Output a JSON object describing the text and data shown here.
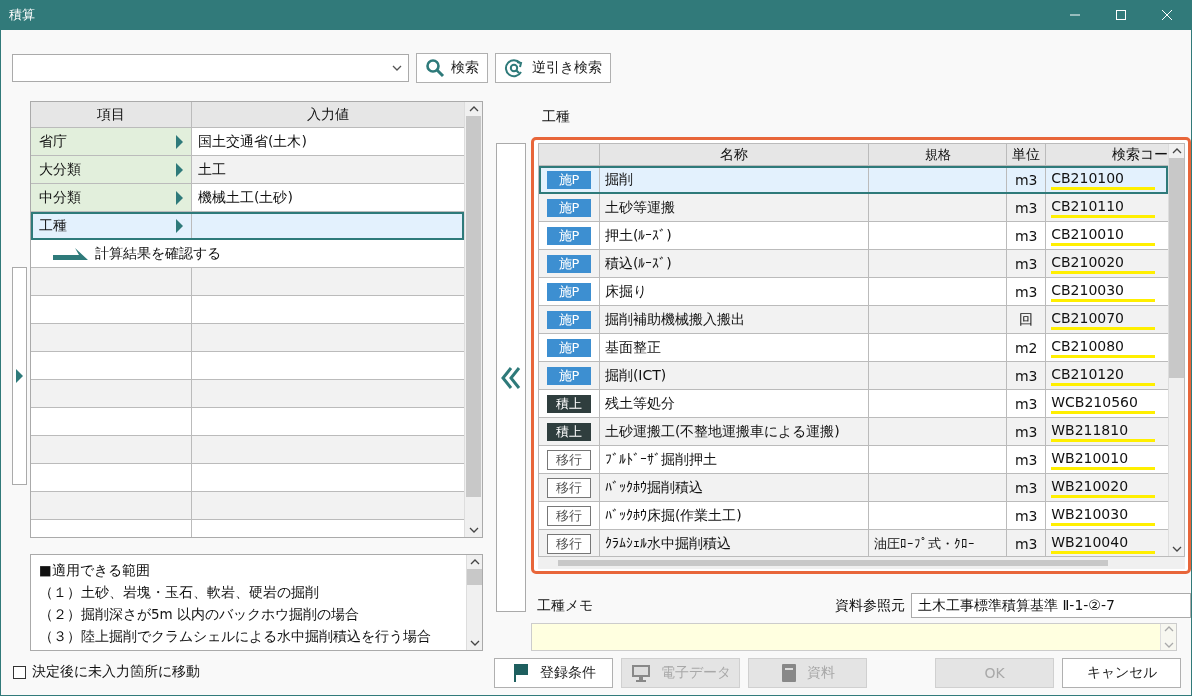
{
  "window": {
    "title": "積算"
  },
  "search": {
    "search_button": "検索",
    "reverse_button": "逆引き検索"
  },
  "input_grid": {
    "columns": [
      "項目",
      "入力値"
    ],
    "rows": [
      {
        "kind": "field",
        "label": "省庁",
        "value": "国土交通省(土木)",
        "selected": false
      },
      {
        "kind": "field",
        "label": "大分類",
        "value": "土工",
        "selected": false
      },
      {
        "kind": "field",
        "label": "中分類",
        "value": "機械土工(土砂)",
        "selected": false
      },
      {
        "kind": "field",
        "label": "工種",
        "value": "",
        "selected": true
      }
    ],
    "result_link": "計算結果を確認する"
  },
  "scope": {
    "lines": [
      "■適用できる範囲",
      "（１）土砂、岩塊・玉石、軟岩、硬岩の掘削",
      "（２）掘削深さが5m 以内のバックホウ掘削の場合",
      "（３）陸上掘削でクラムシェルによる水中掘削積込を行う場合"
    ]
  },
  "move_to_unfilled": {
    "label": "決定後に未入力箇所に移動",
    "checked": false
  },
  "work_type": {
    "label": "工種",
    "columns": [
      "",
      "名称",
      "規格",
      "単位",
      "検索コー"
    ],
    "rows": [
      {
        "badge": "施P",
        "kind": "filled",
        "name": "掘削",
        "spec": "",
        "unit": "m3",
        "code": "CB210100",
        "selected": true
      },
      {
        "badge": "施P",
        "kind": "filled",
        "name": "土砂等運搬",
        "spec": "",
        "unit": "m3",
        "code": "CB210110",
        "selected": false
      },
      {
        "badge": "施P",
        "kind": "filled",
        "name": "押土(ﾙｰｽﾞ)",
        "spec": "",
        "unit": "m3",
        "code": "CB210010",
        "selected": false
      },
      {
        "badge": "施P",
        "kind": "filled",
        "name": "積込(ﾙｰｽﾞ)",
        "spec": "",
        "unit": "m3",
        "code": "CB210020",
        "selected": false
      },
      {
        "badge": "施P",
        "kind": "filled",
        "name": "床掘り",
        "spec": "",
        "unit": "m3",
        "code": "CB210030",
        "selected": false
      },
      {
        "badge": "施P",
        "kind": "filled",
        "name": "掘削補助機械搬入搬出",
        "spec": "",
        "unit": "回",
        "code": "CB210070",
        "selected": false
      },
      {
        "badge": "施P",
        "kind": "filled",
        "name": "基面整正",
        "spec": "",
        "unit": "m2",
        "code": "CB210080",
        "selected": false
      },
      {
        "badge": "施P",
        "kind": "filled",
        "name": "掘削(ICT)",
        "spec": "",
        "unit": "m3",
        "code": "CB210120",
        "selected": false
      },
      {
        "badge": "積上",
        "kind": "dark",
        "name": "残土等処分",
        "spec": "",
        "unit": "m3",
        "code": "WCB210560",
        "selected": false
      },
      {
        "badge": "積上",
        "kind": "dark",
        "name": "土砂運搬工(不整地運搬車による運搬)",
        "spec": "",
        "unit": "m3",
        "code": "WB211810",
        "selected": false
      },
      {
        "badge": "移行",
        "kind": "outline",
        "name": "ﾌﾞﾙﾄﾞｰｻﾞ掘削押土",
        "spec": "",
        "unit": "m3",
        "code": "WB210010",
        "selected": false
      },
      {
        "badge": "移行",
        "kind": "outline",
        "name": "ﾊﾞｯｸﾎｳ掘削積込",
        "spec": "",
        "unit": "m3",
        "code": "WB210020",
        "selected": false
      },
      {
        "badge": "移行",
        "kind": "outline",
        "name": "ﾊﾞｯｸﾎｳ床掘(作業土工)",
        "spec": "",
        "unit": "m3",
        "code": "WB210030",
        "selected": false
      },
      {
        "badge": "移行",
        "kind": "outline",
        "name": "ｸﾗﾑｼｪﾙ水中掘削積込",
        "spec": "油圧ﾛｰﾌﾟ式・ｸﾛｰ",
        "unit": "m3",
        "code": "WB210040",
        "selected": false
      }
    ]
  },
  "memo": {
    "label": "工種メモ",
    "reference_label": "資料参照元",
    "reference": "土木工事標準積算基準 Ⅱ-1-②-7"
  },
  "buttons": [
    {
      "kind": "flag",
      "label": "登録条件",
      "disabled": false
    },
    {
      "kind": "monitor",
      "label": "電子データ",
      "disabled": true
    },
    {
      "kind": "book",
      "label": "資料",
      "disabled": true
    },
    {
      "label": "OK",
      "disabled": true
    },
    {
      "label": "キャンセル",
      "disabled": false
    }
  ]
}
